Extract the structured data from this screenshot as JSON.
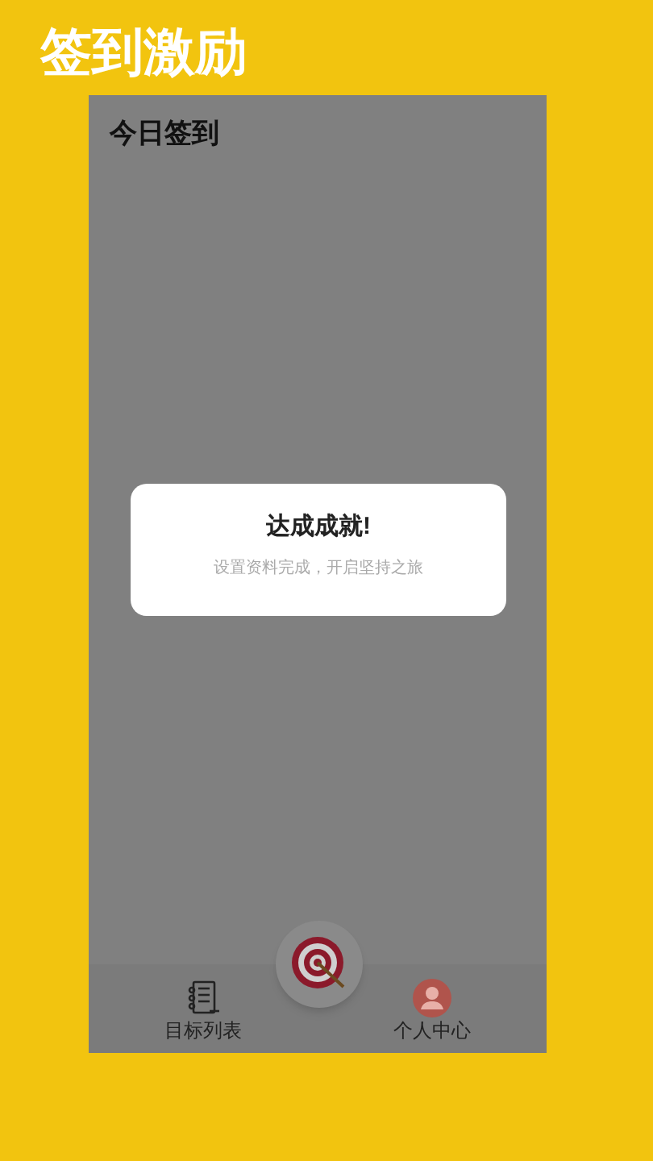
{
  "banner": {
    "title": "签到激励"
  },
  "screen": {
    "title": "今日签到"
  },
  "dialog": {
    "title": "达成成就!",
    "message": "设置资料完成，开启坚持之旅"
  },
  "tab_bar": {
    "tabs": [
      {
        "label": "目标列表",
        "kind": "list"
      },
      {
        "label": "个人中心",
        "kind": "profile"
      }
    ]
  }
}
